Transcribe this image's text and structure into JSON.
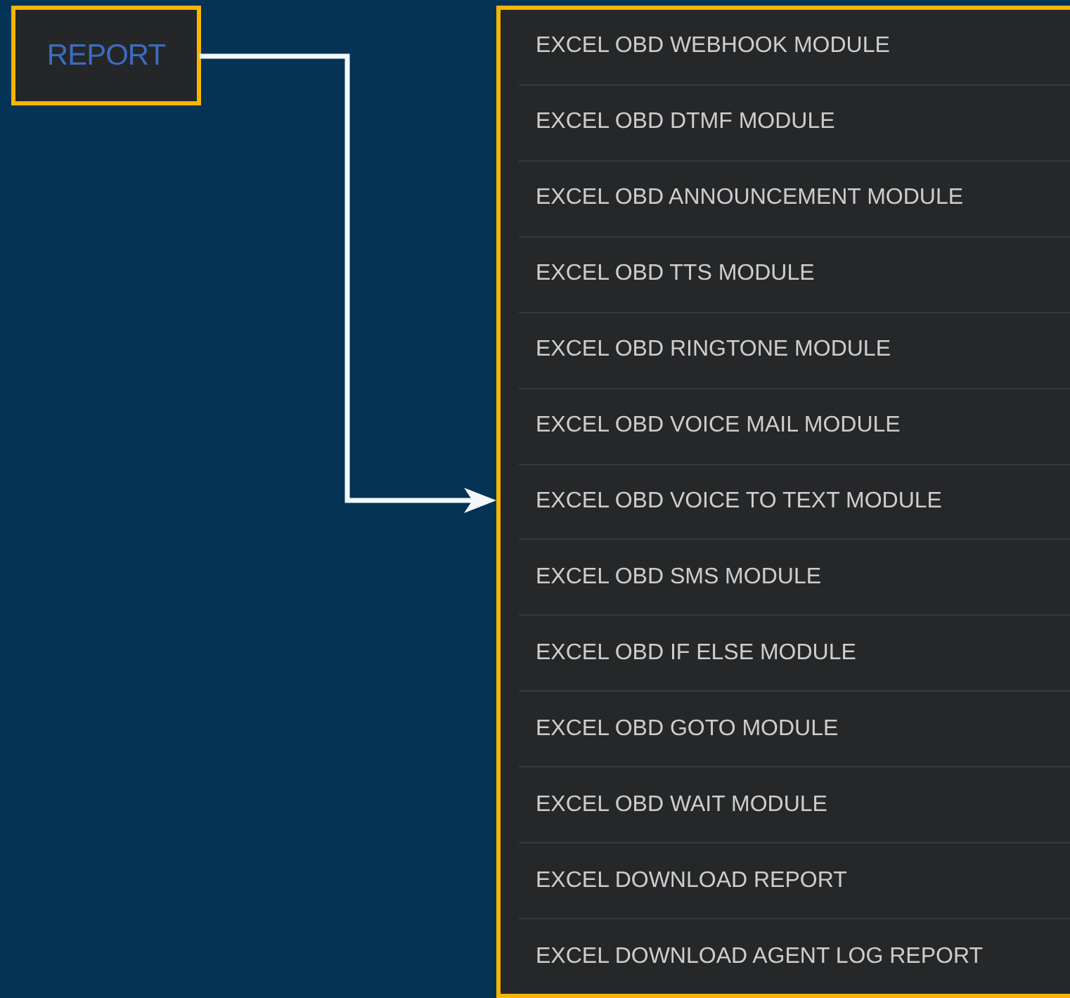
{
  "report_button": {
    "label": "REPORT"
  },
  "menu": {
    "items": [
      {
        "label": "EXCEL OBD WEBHOOK MODULE"
      },
      {
        "label": "EXCEL OBD DTMF MODULE"
      },
      {
        "label": "EXCEL OBD ANNOUNCEMENT MODULE"
      },
      {
        "label": "EXCEL OBD TTS MODULE"
      },
      {
        "label": "EXCEL OBD RINGTONE MODULE"
      },
      {
        "label": "EXCEL OBD VOICE MAIL MODULE"
      },
      {
        "label": "EXCEL OBD VOICE TO TEXT MODULE"
      },
      {
        "label": "EXCEL OBD SMS MODULE"
      },
      {
        "label": "EXCEL OBD IF ELSE MODULE"
      },
      {
        "label": "EXCEL OBD GOTO MODULE"
      },
      {
        "label": "EXCEL OBD WAIT MODULE"
      },
      {
        "label": "EXCEL DOWNLOAD REPORT"
      },
      {
        "label": "EXCEL DOWNLOAD AGENT LOG REPORT"
      }
    ]
  }
}
